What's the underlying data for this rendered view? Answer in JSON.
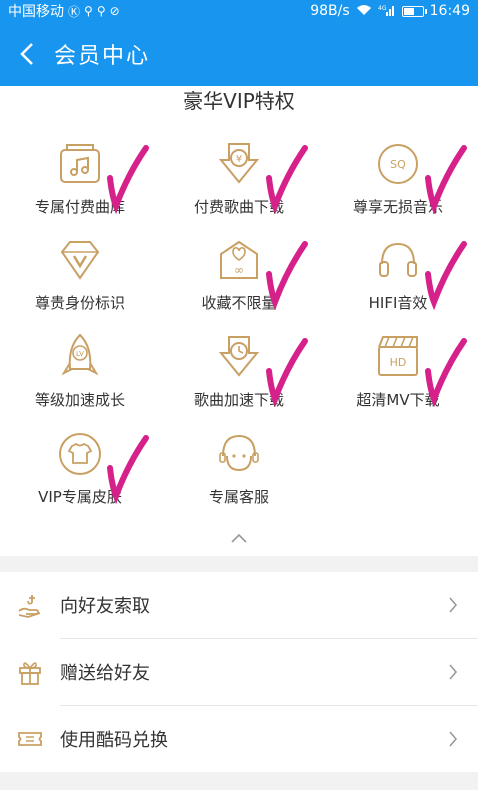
{
  "status_bar": {
    "carrier": "中国移动",
    "speed": "98B/s",
    "network": "4G",
    "time": "16:49",
    "battery_pct": 60
  },
  "header": {
    "title": "会员中心"
  },
  "privileges": {
    "title": "豪华VIP特权",
    "items": [
      {
        "label": "专属付费曲库",
        "icon": "music-library-icon",
        "checked": true
      },
      {
        "label": "付费歌曲下载",
        "icon": "paid-download-icon",
        "checked": true
      },
      {
        "label": "尊享无损音乐",
        "icon": "sq-lossless-icon",
        "checked": true
      },
      {
        "label": "尊贵身份标识",
        "icon": "diamond-v-icon",
        "checked": false
      },
      {
        "label": "收藏不限量",
        "icon": "unlimited-favorites-icon",
        "checked": true
      },
      {
        "label": "HIFI音效",
        "icon": "headphones-icon",
        "checked": true
      },
      {
        "label": "等级加速成长",
        "icon": "rocket-lv-icon",
        "checked": false
      },
      {
        "label": "歌曲加速下载",
        "icon": "fast-download-icon",
        "checked": true
      },
      {
        "label": "超清MV下载",
        "icon": "hd-clapper-icon",
        "checked": true
      },
      {
        "label": "VIP专属皮肤",
        "icon": "tshirt-skin-icon",
        "checked": true
      },
      {
        "label": "专属客服",
        "icon": "customer-service-icon",
        "checked": false
      }
    ]
  },
  "actions": [
    {
      "label": "向好友索取",
      "icon": "hand-request-icon"
    },
    {
      "label": "赠送给好友",
      "icon": "gift-icon"
    },
    {
      "label": "使用酷码兑换",
      "icon": "ticket-icon"
    }
  ],
  "colors": {
    "brand_blue": "#1896ef",
    "icon_gold": "#c9a063",
    "check_magenta": "#d6208a"
  }
}
